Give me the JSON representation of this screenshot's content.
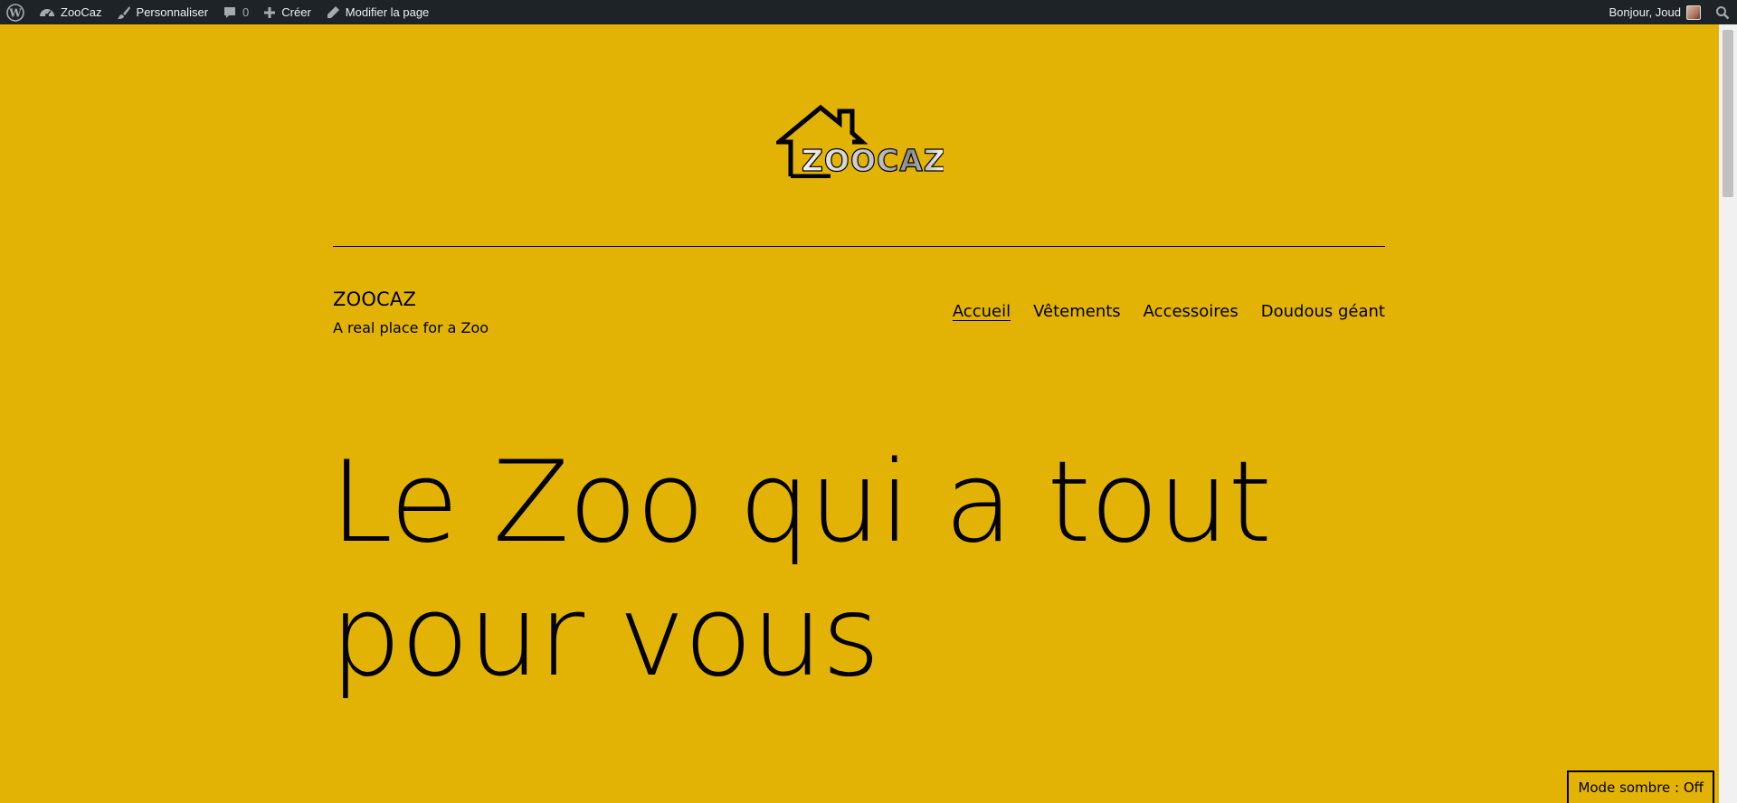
{
  "adminbar": {
    "site_name": "ZooCaz",
    "customize": "Personnaliser",
    "comments_count": "0",
    "new": "Créer",
    "edit": "Modifier la page",
    "greeting": "Bonjour, Joud"
  },
  "site": {
    "logo_text": "ZOOCAZ",
    "title": "ZOOCAZ",
    "tagline": "A real place for a Zoo"
  },
  "nav": {
    "items": [
      "Accueil",
      "Vêtements",
      "Accessoires",
      "Doudous géant"
    ]
  },
  "hero": {
    "line1": "Le Zoo qui a tout",
    "line2": "pour vous"
  },
  "dark_mode": {
    "label": "Mode sombre : Off"
  },
  "colors": {
    "background": "#e2b304",
    "adminbar": "#1d2327"
  }
}
